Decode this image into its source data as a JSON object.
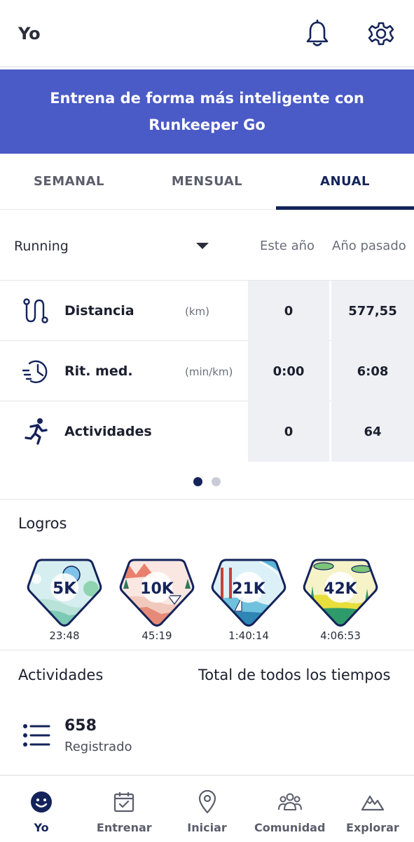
{
  "header": {
    "title": "Yo",
    "icons": [
      "bell-icon",
      "gear-icon"
    ]
  },
  "banner": {
    "text": "Entrena de forma más inteligente con Runkeeper Go"
  },
  "tabs": [
    {
      "label": "SEMANAL",
      "active": false
    },
    {
      "label": "MENSUAL",
      "active": false
    },
    {
      "label": "ANUAL",
      "active": true
    }
  ],
  "stats": {
    "sport": "Running",
    "col_current": "Este año",
    "col_previous": "Año pasado",
    "rows": [
      {
        "icon": "route-icon",
        "label": "Distancia",
        "unit": "(km)",
        "current": "0",
        "previous": "577,55"
      },
      {
        "icon": "pace-clock-icon",
        "label": "Rit. med.",
        "unit": "(min/km)",
        "current": "0:00",
        "previous": "6:08"
      },
      {
        "icon": "runner-icon",
        "label": "Actividades",
        "unit": "",
        "current": "0",
        "previous": "64"
      }
    ],
    "pager": {
      "pages": 2,
      "active": 1
    }
  },
  "logros": {
    "title": "Logros",
    "badges": [
      {
        "label": "5K",
        "time": "23:48"
      },
      {
        "label": "10K",
        "time": "45:19"
      },
      {
        "label": "21K",
        "time": "1:40:14"
      },
      {
        "label": "42K",
        "time": "4:06:53"
      }
    ]
  },
  "actividades": {
    "title": "Actividades",
    "total_label": "Total de todos los tiempos",
    "count": "658",
    "count_label": "Registrado"
  },
  "bottom_nav": [
    {
      "label": "Yo",
      "icon": "smiley-icon",
      "active": true
    },
    {
      "label": "Entrenar",
      "icon": "calendar-check-icon",
      "active": false
    },
    {
      "label": "Iniciar",
      "icon": "location-pin-icon",
      "active": false
    },
    {
      "label": "Comunidad",
      "icon": "group-icon",
      "active": false
    },
    {
      "label": "Explorar",
      "icon": "mountain-icon",
      "active": false
    }
  ],
  "colors": {
    "accent": "#14235a",
    "banner": "#4a5ac6",
    "cell_bg": "#eef0f4"
  }
}
